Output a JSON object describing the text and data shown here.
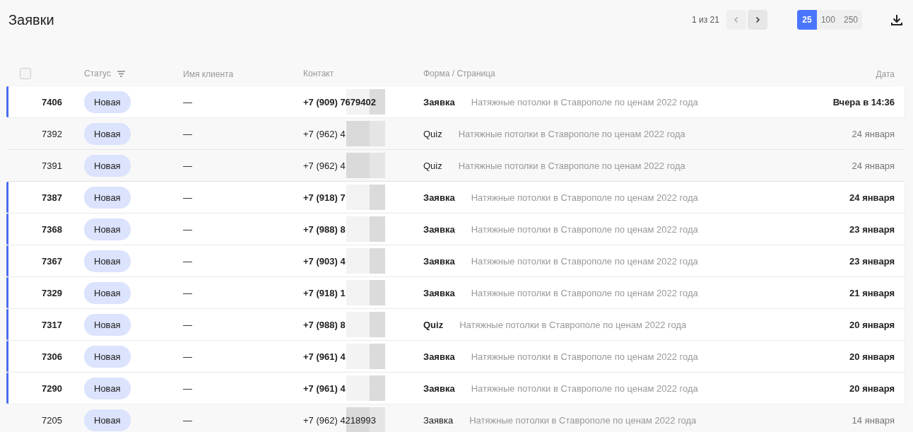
{
  "title": "Заявки",
  "pagination": {
    "info": "1 из 21",
    "prev_disabled": true,
    "next_disabled": false
  },
  "page_sizes": [
    {
      "label": "25",
      "selected": true
    },
    {
      "label": "100",
      "selected": false
    },
    {
      "label": "250",
      "selected": false
    }
  ],
  "table": {
    "select_all_checked": false,
    "columns": [
      "Статус",
      "Имя клиента",
      "Контакт",
      "Форма / Страница",
      "Дата"
    ],
    "rows": [
      {
        "id": "7406",
        "unread": true,
        "status": "Новая",
        "client": "—",
        "contact": "+7 (909) 7679402",
        "form": "Заявка",
        "page": "Натяжные потолки в Ставрополе по ценам 2022 года",
        "date": "Вчера в 14:36"
      },
      {
        "id": "7392",
        "unread": false,
        "status": "Новая",
        "client": "—",
        "contact": "+7 (962) 4",
        "form": "Quiz",
        "page": "Натяжные потолки в Ставрополе по ценам 2022 года",
        "date": "24 января"
      },
      {
        "id": "7391",
        "unread": false,
        "status": "Новая",
        "client": "—",
        "contact": "+7 (962) 4",
        "form": "Quiz",
        "page": "Натяжные потолки в Ставрополе по ценам 2022 года",
        "date": "24 января"
      },
      {
        "id": "7387",
        "unread": true,
        "status": "Новая",
        "client": "—",
        "contact": "+7 (918) 7",
        "form": "Заявка",
        "page": "Натяжные потолки в Ставрополе по ценам 2022 года",
        "date": "24 января"
      },
      {
        "id": "7368",
        "unread": true,
        "status": "Новая",
        "client": "—",
        "contact": "+7 (988) 8",
        "form": "Заявка",
        "page": "Натяжные потолки в Ставрополе по ценам 2022 года",
        "date": "23 января"
      },
      {
        "id": "7367",
        "unread": true,
        "status": "Новая",
        "client": "—",
        "contact": "+7 (903) 4",
        "form": "Заявка",
        "page": "Натяжные потолки в Ставрополе по ценам 2022 года",
        "date": "23 января"
      },
      {
        "id": "7329",
        "unread": true,
        "status": "Новая",
        "client": "—",
        "contact": "+7 (918) 1",
        "form": "Заявка",
        "page": "Натяжные потолки в Ставрополе по ценам 2022 года",
        "date": "21 января"
      },
      {
        "id": "7317",
        "unread": true,
        "status": "Новая",
        "client": "—",
        "contact": "+7 (988) 8",
        "form": "Quiz",
        "page": "Натяжные потолки в Ставрополе по ценам 2022 года",
        "date": "20 января"
      },
      {
        "id": "7306",
        "unread": true,
        "status": "Новая",
        "client": "—",
        "contact": "+7 (961) 4",
        "form": "Заявка",
        "page": "Натяжные потолки в Ставрополе по ценам 2022 года",
        "date": "20 января"
      },
      {
        "id": "7290",
        "unread": true,
        "status": "Новая",
        "client": "—",
        "contact": "+7 (961) 4",
        "form": "Заявка",
        "page": "Натяжные потолки в Ставрополе по ценам 2022 года",
        "date": "20 января"
      },
      {
        "id": "7205",
        "unread": false,
        "status": "Новая",
        "client": "—",
        "contact": "+7 (962) 4218993",
        "form": "Заявка",
        "page": "Натяжные потолки в Ставрополе по ценам 2022 года",
        "date": "14 января"
      }
    ]
  }
}
